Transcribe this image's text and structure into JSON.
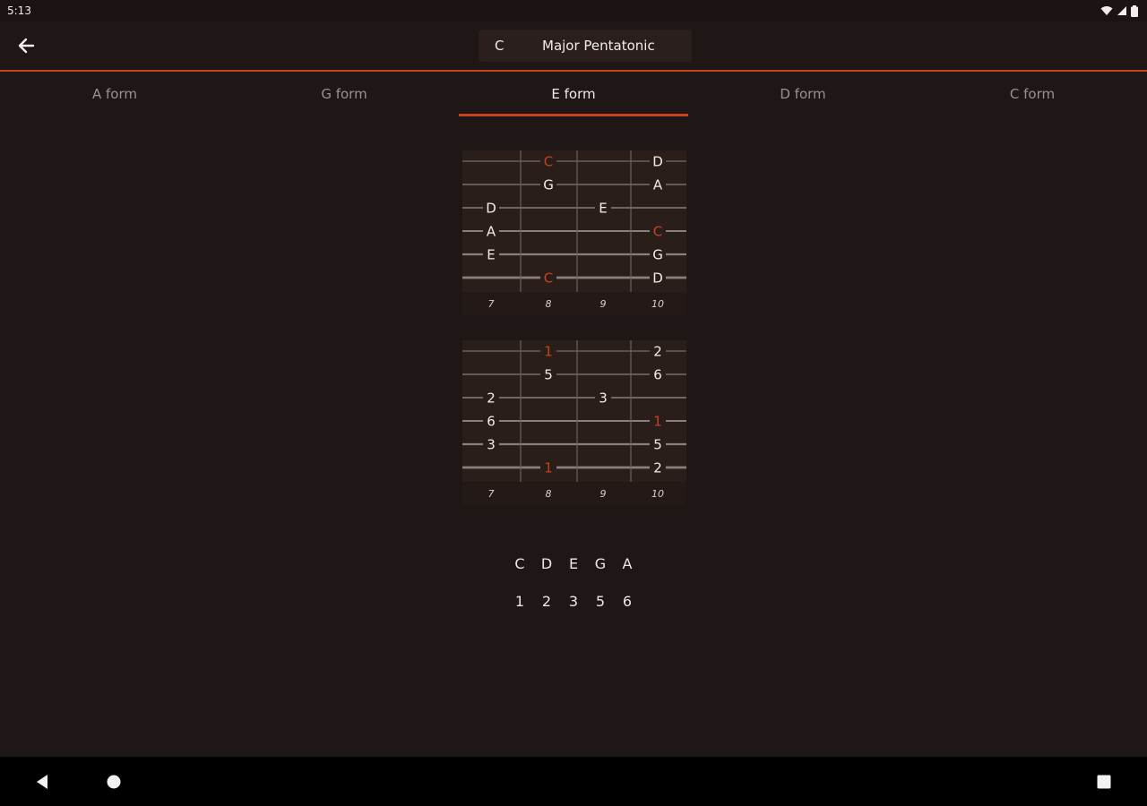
{
  "status_bar": {
    "time": "5:13",
    "icons": [
      "wifi-icon",
      "signal-icon",
      "battery-icon"
    ]
  },
  "app_bar": {
    "key": "C",
    "scale": "Major Pentatonic",
    "back_icon": "arrow-left-icon"
  },
  "tabs": [
    {
      "label": "A form",
      "active": false
    },
    {
      "label": "G form",
      "active": false
    },
    {
      "label": "E form",
      "active": true
    },
    {
      "label": "D form",
      "active": false
    },
    {
      "label": "C form",
      "active": false
    }
  ],
  "fret_numbers": [
    "7",
    "8",
    "9",
    "10"
  ],
  "note_diagram": {
    "notes": [
      {
        "string": 1,
        "fret": 8,
        "label": "C",
        "root": true
      },
      {
        "string": 1,
        "fret": 10,
        "label": "D",
        "root": false
      },
      {
        "string": 2,
        "fret": 8,
        "label": "G",
        "root": false
      },
      {
        "string": 2,
        "fret": 10,
        "label": "A",
        "root": false
      },
      {
        "string": 3,
        "fret": 7,
        "label": "D",
        "root": false
      },
      {
        "string": 3,
        "fret": 9,
        "label": "E",
        "root": false
      },
      {
        "string": 4,
        "fret": 7,
        "label": "A",
        "root": false
      },
      {
        "string": 4,
        "fret": 10,
        "label": "C",
        "root": true
      },
      {
        "string": 5,
        "fret": 7,
        "label": "E",
        "root": false
      },
      {
        "string": 5,
        "fret": 10,
        "label": "G",
        "root": false
      },
      {
        "string": 6,
        "fret": 8,
        "label": "C",
        "root": true
      },
      {
        "string": 6,
        "fret": 10,
        "label": "D",
        "root": false
      }
    ]
  },
  "degree_diagram": {
    "notes": [
      {
        "string": 1,
        "fret": 8,
        "label": "1",
        "root": true
      },
      {
        "string": 1,
        "fret": 10,
        "label": "2",
        "root": false
      },
      {
        "string": 2,
        "fret": 8,
        "label": "5",
        "root": false
      },
      {
        "string": 2,
        "fret": 10,
        "label": "6",
        "root": false
      },
      {
        "string": 3,
        "fret": 7,
        "label": "2",
        "root": false
      },
      {
        "string": 3,
        "fret": 9,
        "label": "3",
        "root": false
      },
      {
        "string": 4,
        "fret": 7,
        "label": "6",
        "root": false
      },
      {
        "string": 4,
        "fret": 10,
        "label": "1",
        "root": true
      },
      {
        "string": 5,
        "fret": 7,
        "label": "3",
        "root": false
      },
      {
        "string": 5,
        "fret": 10,
        "label": "5",
        "root": false
      },
      {
        "string": 6,
        "fret": 8,
        "label": "1",
        "root": true
      },
      {
        "string": 6,
        "fret": 10,
        "label": "2",
        "root": false
      }
    ]
  },
  "scale_notes": [
    "C",
    "D",
    "E",
    "G",
    "A"
  ],
  "scale_degrees": [
    "1",
    "2",
    "3",
    "5",
    "6"
  ],
  "colors": {
    "accent": "#c4431d",
    "background": "#1f1716",
    "text": "#e8e4e2"
  },
  "nav_bar": {
    "icons": [
      "back-triangle-icon",
      "home-circle-icon",
      "recents-square-icon"
    ]
  }
}
